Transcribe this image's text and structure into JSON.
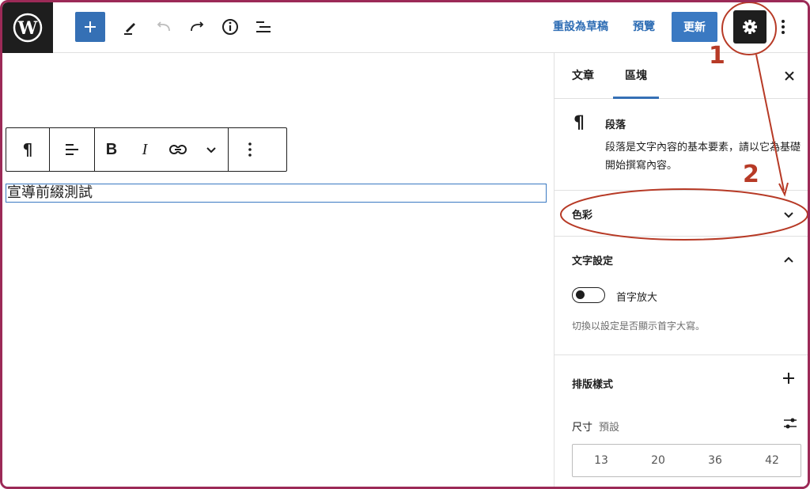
{
  "topbar": {
    "revert_draft_label": "重設為草稿",
    "preview_label": "預覽",
    "update_label": "更新"
  },
  "block_toolbar": {
    "paragraph_icon": "¶",
    "bold_label": "B",
    "italic_label": "I"
  },
  "editor": {
    "paragraph_text": "宣導前綴測試"
  },
  "sidebar": {
    "tabs": [
      {
        "label": "文章"
      },
      {
        "label": "區塊"
      }
    ],
    "block_card": {
      "icon": "¶",
      "title": "段落",
      "description": "段落是文字內容的基本要素，請以它為基礎開始撰寫內容。"
    },
    "color_panel": {
      "title": "色彩"
    },
    "typography_panel": {
      "title": "文字設定",
      "toggle_label": "首字放大",
      "help_text": "切換以設定是否顯示首字大寫。"
    },
    "layout_panel": {
      "title": "排版樣式",
      "size_label": "尺寸",
      "size_default": "預設",
      "size_options": [
        "13",
        "20",
        "36",
        "42"
      ]
    }
  },
  "annotations": {
    "marker_1": "1",
    "marker_2": "2",
    "color": "#b73a26"
  },
  "colors": {
    "accent": "#3570b5",
    "dark": "#1e1e1e",
    "frame": "#9c2a57"
  }
}
